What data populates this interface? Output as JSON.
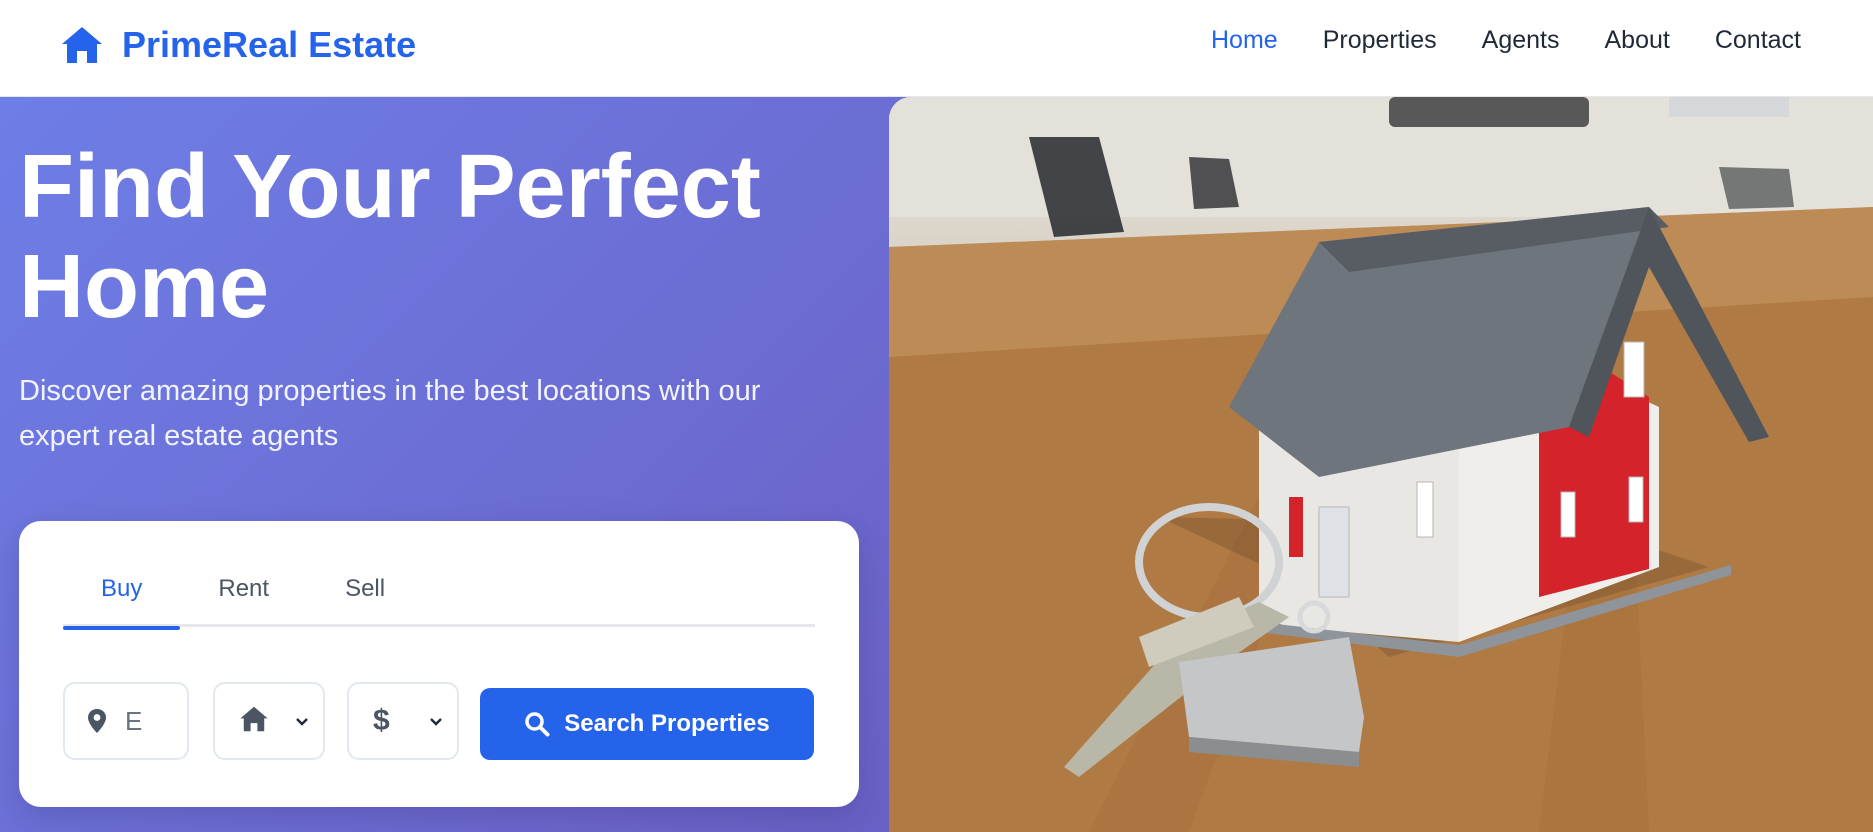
{
  "header": {
    "brand": {
      "icon": "home-icon",
      "name": "PrimeReal Estate"
    },
    "nav": [
      {
        "label": "Home",
        "active": true
      },
      {
        "label": "Properties",
        "active": false
      },
      {
        "label": "Agents",
        "active": false
      },
      {
        "label": "About",
        "active": false
      },
      {
        "label": "Contact",
        "active": false
      }
    ]
  },
  "hero": {
    "title_line1": "Find Your Perfect",
    "title_line2": "Home",
    "subtitle": "Discover amazing properties in the best locations with our expert real estate agents",
    "image": {
      "description_icon": "house-model-with-keys-photo"
    }
  },
  "search": {
    "tabs": [
      {
        "label": "Buy",
        "active": true
      },
      {
        "label": "Rent",
        "active": false
      },
      {
        "label": "Sell",
        "active": false
      }
    ],
    "location": {
      "icon": "map-pin-icon",
      "value": "E"
    },
    "type_select": {
      "icon": "home-icon"
    },
    "price_select": {
      "icon": "dollar-icon",
      "symbol": "$"
    },
    "button": {
      "icon": "search-icon",
      "label": "Search Properties"
    }
  },
  "colors": {
    "accent": "#2563eb",
    "hero_gradient_start": "#6d7ee6",
    "hero_gradient_end": "#5a4fb1",
    "text_dark": "#1f2937"
  }
}
